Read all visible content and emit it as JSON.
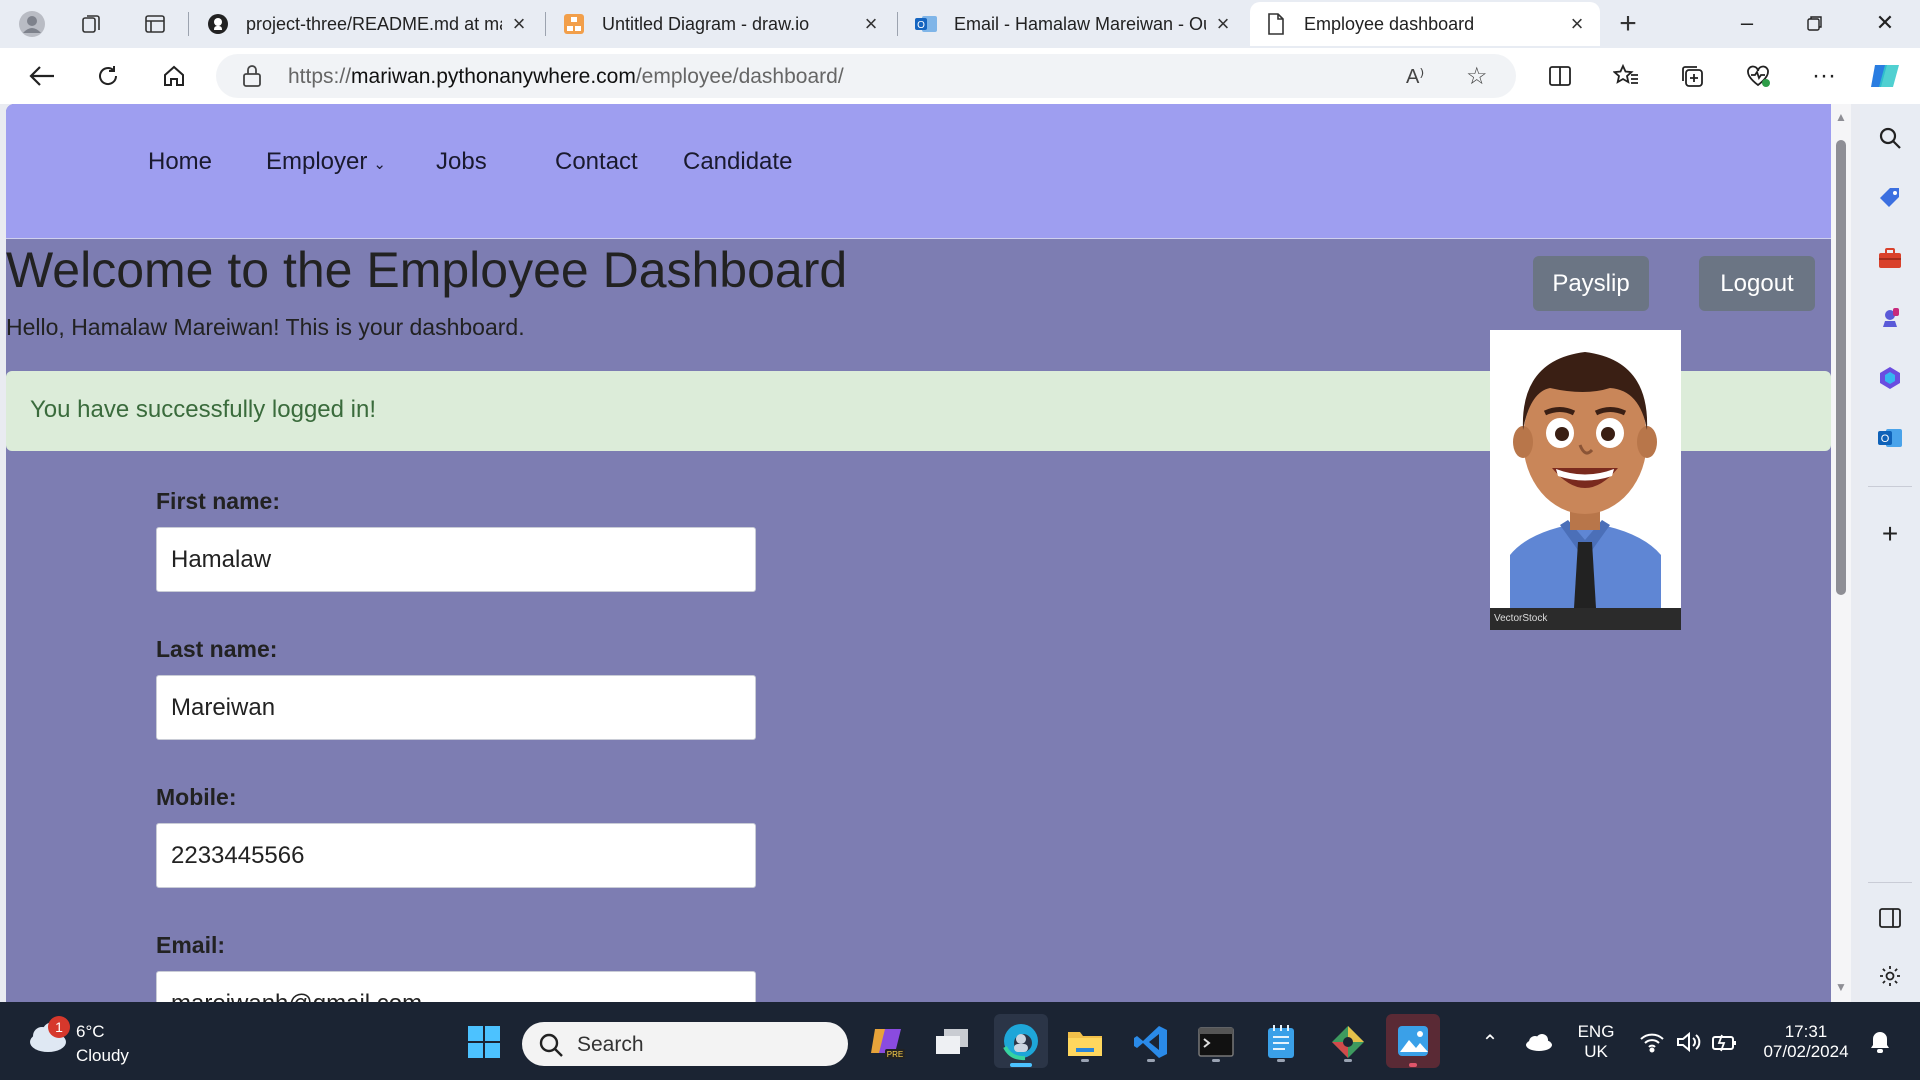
{
  "browser": {
    "tabs": [
      {
        "title": "project-three/README.md at main",
        "favicon": "github-icon",
        "active": false
      },
      {
        "title": "Untitled Diagram - draw.io",
        "favicon": "drawio-icon",
        "active": false
      },
      {
        "title": "Email - Hamalaw Mareiwan - Outlook",
        "favicon": "outlook-icon",
        "active": false
      },
      {
        "title": "Employee dashboard",
        "favicon": "page-icon",
        "active": true
      }
    ],
    "new_tab_label": "+",
    "address": {
      "scheme": "https://",
      "host": "mariwan.pythonanywhere.com",
      "path": "/employee/dashboard/"
    },
    "read_aloud_label": "A⁾"
  },
  "site": {
    "nav": {
      "home": "Home",
      "employer": "Employer",
      "jobs": "Jobs",
      "contact": "Contact",
      "candidate": "Candidate"
    },
    "heading": "Welcome to the Employee Dashboard",
    "greeting": "Hello, Hamalaw Mareiwan! This is your dashboard.",
    "payslip_label": "Payslip",
    "logout_label": "Logout",
    "alert": "You have successfully logged in!",
    "avatar_watermark": "VectorStock",
    "form": {
      "first_name_label": "First name:",
      "first_name_value": "Hamalaw",
      "last_name_label": "Last name:",
      "last_name_value": "Mareiwan",
      "mobile_label": "Mobile:",
      "mobile_value": "2233445566",
      "email_label": "Email:",
      "email_value": "mareiwanh@gmail.com"
    }
  },
  "taskbar": {
    "weather_temp": "6°C",
    "weather_condition": "Cloudy",
    "weather_badge": "1",
    "search_placeholder": "Search",
    "language_line1": "ENG",
    "language_line2": "UK",
    "time": "17:31",
    "date": "07/02/2024"
  },
  "colors": {
    "page_bg": "#7d7db2",
    "nav_bg": "#9e9ef0",
    "alert_bg": "#dcecd9",
    "alert_text": "#3a6b3c",
    "button_bg": "#6b7584"
  }
}
